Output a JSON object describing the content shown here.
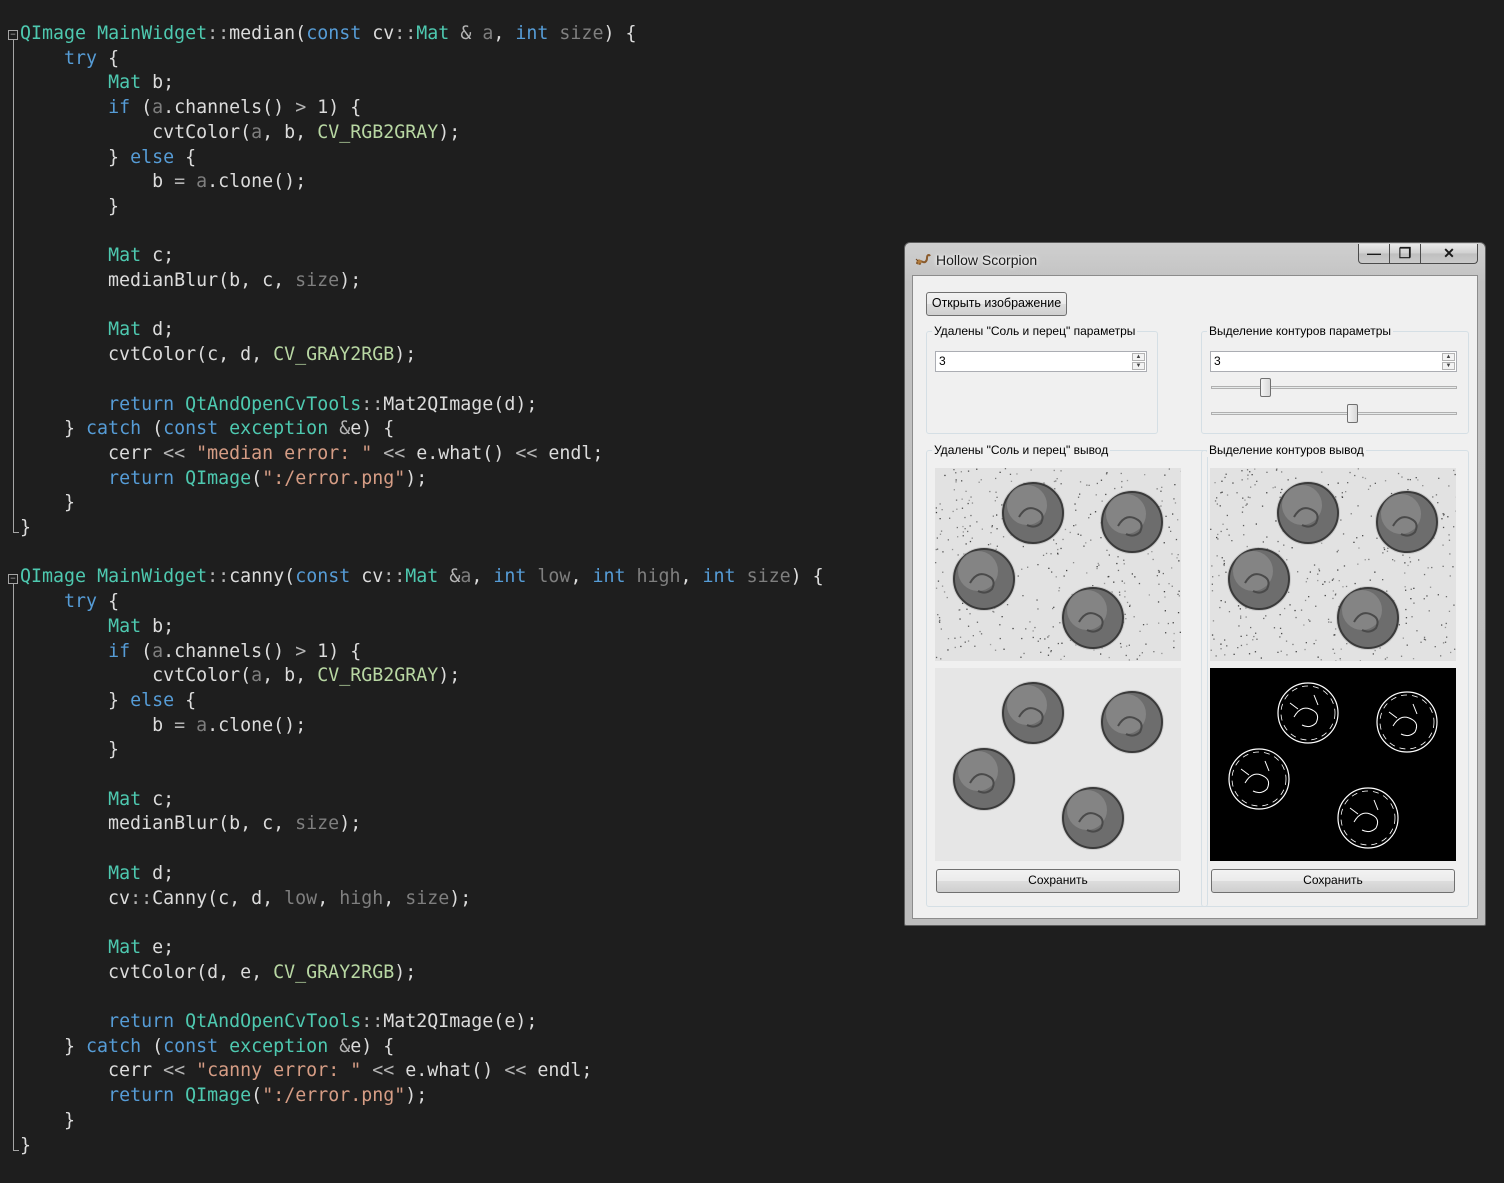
{
  "code": {
    "lines": [
      [
        [
          "t",
          "QImage"
        ],
        [
          "",
          "·"
        ],
        [
          "t",
          "MainWidget"
        ],
        [
          "o",
          "::"
        ],
        [
          "",
          "median("
        ],
        [
          "k",
          "const"
        ],
        [
          "",
          " cv"
        ],
        [
          "o",
          "::"
        ],
        [
          "t",
          "Mat"
        ],
        [
          "",
          " "
        ],
        [
          "o",
          "&"
        ],
        [
          "",
          " "
        ],
        [
          "p",
          "a"
        ],
        [
          "",
          ", "
        ],
        [
          "k",
          "int"
        ],
        [
          "",
          " "
        ],
        [
          "p",
          "size"
        ],
        [
          "",
          ") {"
        ]
      ],
      [
        [
          "",
          "    "
        ],
        [
          "k",
          "try"
        ],
        [
          "",
          " {"
        ]
      ],
      [
        [
          "",
          "        "
        ],
        [
          "t",
          "Mat"
        ],
        [
          "",
          " b;"
        ]
      ],
      [
        [
          "",
          "        "
        ],
        [
          "k",
          "if"
        ],
        [
          "",
          " ("
        ],
        [
          "p",
          "a"
        ],
        [
          "",
          ".channels() "
        ],
        [
          "o",
          ">"
        ],
        [
          "",
          " 1) {"
        ]
      ],
      [
        [
          "",
          "            cvtColor("
        ],
        [
          "p",
          "a"
        ],
        [
          "",
          ", b, "
        ],
        [
          "m",
          "CV_RGB2GRAY"
        ],
        [
          "",
          ");"
        ]
      ],
      [
        [
          "",
          "        } "
        ],
        [
          "k",
          "else"
        ],
        [
          "",
          " {"
        ]
      ],
      [
        [
          "",
          "            b "
        ],
        [
          "o",
          "="
        ],
        [
          "",
          " "
        ],
        [
          "p",
          "a"
        ],
        [
          "",
          ".clone();"
        ]
      ],
      [
        [
          "",
          "        }"
        ]
      ],
      [],
      [
        [
          "",
          "        "
        ],
        [
          "t",
          "Mat"
        ],
        [
          "",
          " c;"
        ]
      ],
      [
        [
          "",
          "        medianBlur(b, c, "
        ],
        [
          "p",
          "size"
        ],
        [
          "",
          ");"
        ]
      ],
      [],
      [
        [
          "",
          "        "
        ],
        [
          "t",
          "Mat"
        ],
        [
          "",
          " d;"
        ]
      ],
      [
        [
          "",
          "        cvtColor(c, d, "
        ],
        [
          "m",
          "CV_GRAY2RGB"
        ],
        [
          "",
          ");"
        ]
      ],
      [],
      [
        [
          "",
          "        "
        ],
        [
          "k",
          "return"
        ],
        [
          "",
          " "
        ],
        [
          "t",
          "QtAndOpenCvTools"
        ],
        [
          "o",
          "::"
        ],
        [
          "",
          "Mat2QImage(d);"
        ]
      ],
      [
        [
          "",
          "    } "
        ],
        [
          "k",
          "catch"
        ],
        [
          "",
          " ("
        ],
        [
          "k",
          "const"
        ],
        [
          "",
          " "
        ],
        [
          "t",
          "exception"
        ],
        [
          "",
          " "
        ],
        [
          "o",
          "&"
        ],
        [
          "",
          "e) {"
        ]
      ],
      [
        [
          "",
          "        cerr "
        ],
        [
          "o",
          "<<"
        ],
        [
          "",
          " "
        ],
        [
          "s",
          "\"median error: \""
        ],
        [
          "",
          " "
        ],
        [
          "o",
          "<<"
        ],
        [
          "",
          " e.what() "
        ],
        [
          "o",
          "<<"
        ],
        [
          "",
          " endl;"
        ]
      ],
      [
        [
          "",
          "        "
        ],
        [
          "k",
          "return"
        ],
        [
          "",
          " "
        ],
        [
          "t",
          "QImage"
        ],
        [
          "",
          "("
        ],
        [
          "s",
          "\":/error.png\""
        ],
        [
          "",
          ");"
        ]
      ],
      [
        [
          "",
          "    }"
        ]
      ],
      [
        [
          "",
          "}"
        ]
      ],
      [],
      [
        [
          "t",
          "QImage"
        ],
        [
          "",
          "·"
        ],
        [
          "t",
          "MainWidget"
        ],
        [
          "o",
          "::"
        ],
        [
          "",
          "canny("
        ],
        [
          "k",
          "const"
        ],
        [
          "",
          " cv"
        ],
        [
          "o",
          "::"
        ],
        [
          "t",
          "Mat"
        ],
        [
          "",
          " "
        ],
        [
          "o",
          "&"
        ],
        [
          "p",
          "a"
        ],
        [
          "",
          ", "
        ],
        [
          "k",
          "int"
        ],
        [
          "",
          " "
        ],
        [
          "p",
          "low"
        ],
        [
          "",
          ", "
        ],
        [
          "k",
          "int"
        ],
        [
          "",
          " "
        ],
        [
          "p",
          "high"
        ],
        [
          "",
          ", "
        ],
        [
          "k",
          "int"
        ],
        [
          "",
          " "
        ],
        [
          "p",
          "size"
        ],
        [
          "",
          ") {"
        ]
      ],
      [
        [
          "",
          "    "
        ],
        [
          "k",
          "try"
        ],
        [
          "",
          " {"
        ]
      ],
      [
        [
          "",
          "        "
        ],
        [
          "t",
          "Mat"
        ],
        [
          "",
          " b;"
        ]
      ],
      [
        [
          "",
          "        "
        ],
        [
          "k",
          "if"
        ],
        [
          "",
          " ("
        ],
        [
          "p",
          "a"
        ],
        [
          "",
          ".channels() "
        ],
        [
          "o",
          ">"
        ],
        [
          "",
          " 1) {"
        ]
      ],
      [
        [
          "",
          "            cvtColor("
        ],
        [
          "p",
          "a"
        ],
        [
          "",
          ", b, "
        ],
        [
          "m",
          "CV_RGB2GRAY"
        ],
        [
          "",
          ");"
        ]
      ],
      [
        [
          "",
          "        } "
        ],
        [
          "k",
          "else"
        ],
        [
          "",
          " {"
        ]
      ],
      [
        [
          "",
          "            b "
        ],
        [
          "o",
          "="
        ],
        [
          "",
          " "
        ],
        [
          "p",
          "a"
        ],
        [
          "",
          ".clone();"
        ]
      ],
      [
        [
          "",
          "        }"
        ]
      ],
      [],
      [
        [
          "",
          "        "
        ],
        [
          "t",
          "Mat"
        ],
        [
          "",
          " c;"
        ]
      ],
      [
        [
          "",
          "        medianBlur(b, c, "
        ],
        [
          "p",
          "size"
        ],
        [
          "",
          ");"
        ]
      ],
      [],
      [
        [
          "",
          "        "
        ],
        [
          "t",
          "Mat"
        ],
        [
          "",
          " d;"
        ]
      ],
      [
        [
          "",
          "        cv"
        ],
        [
          "o",
          "::"
        ],
        [
          "",
          "Canny(c, d, "
        ],
        [
          "p",
          "low"
        ],
        [
          "",
          ", "
        ],
        [
          "p",
          "high"
        ],
        [
          "",
          ", "
        ],
        [
          "p",
          "size"
        ],
        [
          "",
          ");"
        ]
      ],
      [],
      [
        [
          "",
          "        "
        ],
        [
          "t",
          "Mat"
        ],
        [
          "",
          " e;"
        ]
      ],
      [
        [
          "",
          "        cvtColor(d, e, "
        ],
        [
          "m",
          "CV_GRAY2RGB"
        ],
        [
          "",
          ");"
        ]
      ],
      [],
      [
        [
          "",
          "        "
        ],
        [
          "k",
          "return"
        ],
        [
          "",
          " "
        ],
        [
          "t",
          "QtAndOpenCvTools"
        ],
        [
          "o",
          "::"
        ],
        [
          "",
          "Mat2QImage(e);"
        ]
      ],
      [
        [
          "",
          "    } "
        ],
        [
          "k",
          "catch"
        ],
        [
          "",
          " ("
        ],
        [
          "k",
          "const"
        ],
        [
          "",
          " "
        ],
        [
          "t",
          "exception"
        ],
        [
          "",
          " "
        ],
        [
          "o",
          "&"
        ],
        [
          "",
          "e) {"
        ]
      ],
      [
        [
          "",
          "        cerr "
        ],
        [
          "o",
          "<<"
        ],
        [
          "",
          " "
        ],
        [
          "s",
          "\"canny error: \""
        ],
        [
          "",
          " "
        ],
        [
          "o",
          "<<"
        ],
        [
          "",
          " e.what() "
        ],
        [
          "o",
          "<<"
        ],
        [
          "",
          " endl;"
        ]
      ],
      [
        [
          "",
          "        "
        ],
        [
          "k",
          "return"
        ],
        [
          "",
          " "
        ],
        [
          "t",
          "QImage"
        ],
        [
          "",
          "("
        ],
        [
          "s",
          "\":/error.png\""
        ],
        [
          "",
          ");"
        ]
      ],
      [
        [
          "",
          "    }"
        ]
      ],
      [
        [
          "",
          "}"
        ]
      ]
    ]
  },
  "window": {
    "title": "Hollow Scorpion",
    "minimize_glyph": "—",
    "maximize_glyph": "❐",
    "close_glyph": "✕",
    "open_button": "Открыть изображение",
    "median_params": {
      "title": "Удалены \"Соль и перец\" параметры",
      "value": "3"
    },
    "canny_params": {
      "title": "Выделение контуров параметры",
      "value": "3",
      "slider_low": 0.21,
      "slider_high": 0.58
    },
    "median_output": {
      "title": "Удалены \"Соль и перец\" вывод",
      "save": "Сохранить"
    },
    "canny_output": {
      "title": "Выделение контуров вывод",
      "save": "Сохранить"
    },
    "icons": {
      "title": "scorpion-icon",
      "spin_up": "▲",
      "spin_down": "▼"
    },
    "colors": {
      "frame": "#c6c6c6",
      "client": "#f0f0f0",
      "canny_bg": "#000000"
    }
  }
}
